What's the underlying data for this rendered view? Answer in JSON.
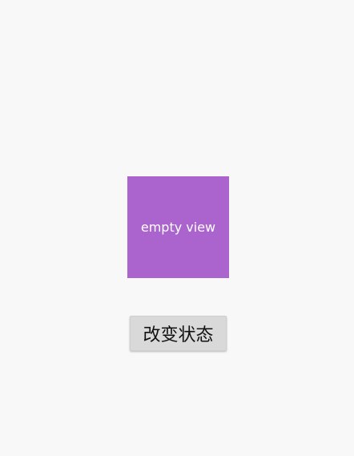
{
  "screen": {
    "background_color": "#f8f8f8"
  },
  "empty_view": {
    "label": "empty view",
    "color": "#ab63cd"
  },
  "change_state_button": {
    "label": "改变状态"
  }
}
